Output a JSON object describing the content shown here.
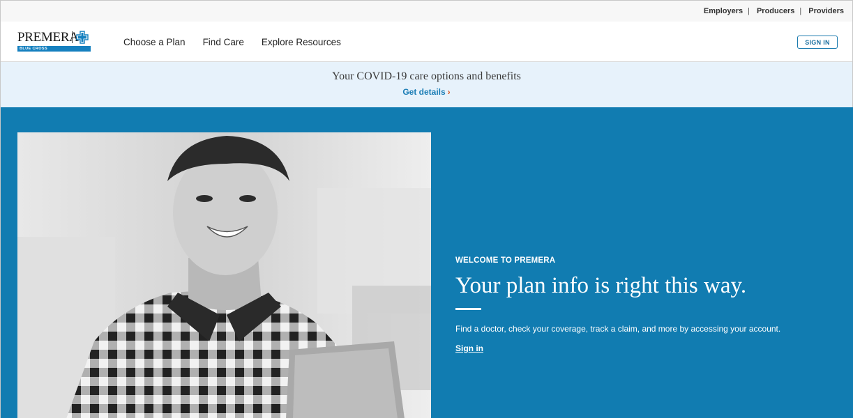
{
  "utility_nav": {
    "items": [
      {
        "label": "Employers"
      },
      {
        "label": "Producers"
      },
      {
        "label": "Providers"
      }
    ],
    "separator": "|"
  },
  "brand": {
    "wordmark": "PREMERA",
    "subline": "BLUE CROSS",
    "accent_color": "#1580bf"
  },
  "main_nav": {
    "items": [
      {
        "label": "Choose a Plan"
      },
      {
        "label": "Find Care"
      },
      {
        "label": "Explore Resources"
      }
    ],
    "sign_in_label": "SIGN IN"
  },
  "covid_banner": {
    "title": "Your COVID-19 care options and benefits",
    "link_label": "Get details",
    "link_icon": "chevron-right-icon"
  },
  "hero": {
    "background_color": "#117cb1",
    "eyebrow": "WELCOME TO PREMERA",
    "headline": "Your plan info is right this way.",
    "description": "Find a doctor, check your coverage, track a claim, and more by accessing your account.",
    "link_label": "Sign in"
  }
}
